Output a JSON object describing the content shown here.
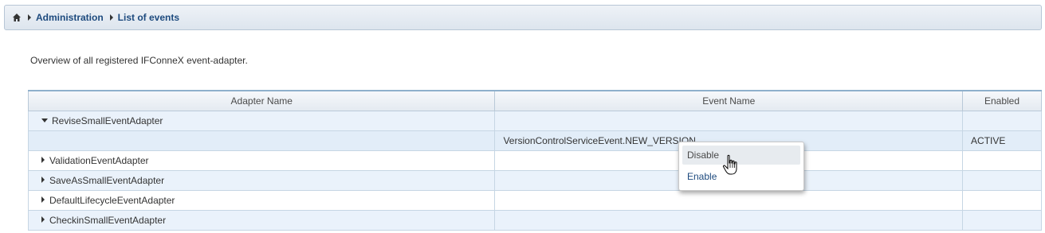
{
  "breadcrumb": {
    "home_icon": "home-icon",
    "items": [
      "Administration",
      "List of events"
    ]
  },
  "intro_text": "Overview of all registered IFConneX event-adapter.",
  "table": {
    "headers": [
      "Adapter Name",
      "Event Name",
      "Enabled"
    ],
    "rows": [
      {
        "adapter": "ReviseSmallEventAdapter",
        "event": "",
        "enabled": "",
        "expanded": true
      },
      {
        "adapter": "",
        "event": "VersionControlServiceEvent.NEW_VERSION",
        "enabled": "ACTIVE"
      },
      {
        "adapter": "ValidationEventAdapter",
        "event": "",
        "enabled": "",
        "expanded": false
      },
      {
        "adapter": "SaveAsSmallEventAdapter",
        "event": "",
        "enabled": "",
        "expanded": false
      },
      {
        "adapter": "DefaultLifecycleEventAdapter",
        "event": "",
        "enabled": "",
        "expanded": false
      },
      {
        "adapter": "CheckinSmallEventAdapter",
        "event": "",
        "enabled": "",
        "expanded": false
      }
    ]
  },
  "context_menu": {
    "items": [
      "Disable",
      "Enable"
    ]
  },
  "colors": {
    "link": "#1d4a7e",
    "header_border": "#8fb0cc",
    "row_alt": "#eaf2fb"
  }
}
